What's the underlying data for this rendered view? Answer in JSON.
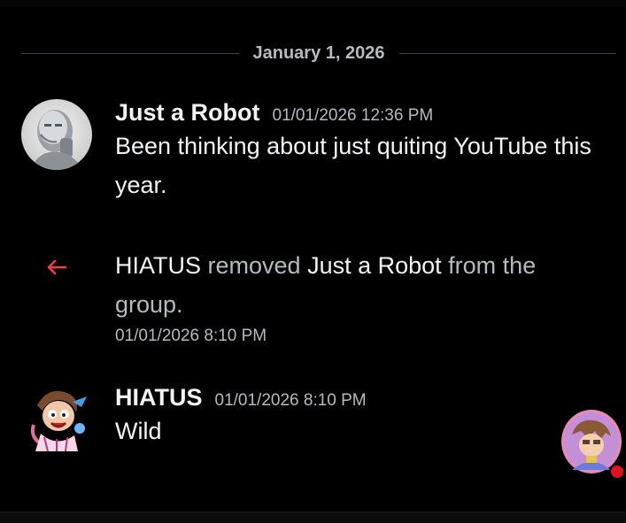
{
  "date_divider": {
    "label": "January 1, 2026"
  },
  "messages": [
    {
      "author": "Just a Robot",
      "timestamp": "01/01/2026 12:36 PM",
      "text": "Been thinking about just quiting YouTube this year.",
      "avatar_icon": "robot-avatar-icon"
    },
    {
      "author": "HIATUS",
      "timestamp": "01/01/2026 8:10 PM",
      "text": "Wild",
      "avatar_icon": "cartoon-avatar-icon"
    }
  ],
  "system_message": {
    "actor": "HIATUS",
    "action_before": " removed ",
    "target": "Just a Robot",
    "action_after": " from the group.",
    "timestamp": "01/01/2026 8:10 PM",
    "icon": "left-arrow-icon",
    "icon_color": "#f23f43"
  },
  "corner_avatar": {
    "icon": "user-avatar-icon",
    "status_color": "#e0111b"
  },
  "colors": {
    "background": "#000000",
    "primary_text": "#f2f3f5",
    "muted_text": "#b5bac1"
  }
}
